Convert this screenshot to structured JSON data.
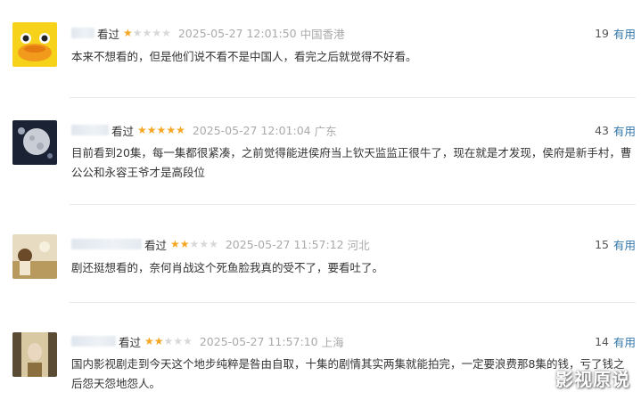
{
  "comments": [
    {
      "username": "",
      "watched_label": "看过",
      "rating": 1,
      "time": "2025-05-27 12:01:50",
      "location": "中国香港",
      "vote_count": "19",
      "vote_label": "有用",
      "content": "本来不想看的，但是他们说不看不是中国人，看完之后就觉得不好看。",
      "avatar": "yellow-duck-avatar"
    },
    {
      "username": "",
      "watched_label": "看过",
      "rating": 5,
      "time": "2025-05-27 12:01:04",
      "location": "广东",
      "vote_count": "43",
      "vote_label": "有用",
      "content": "目前看到20集，每一集都很紧凑，之前觉得能进侯府当上钦天监监正很牛了，现在就是才发现，侯府是新手村，曹公公和永容王爷才是高段位",
      "avatar": "moon-avatar"
    },
    {
      "username": "",
      "watched_label": "看过",
      "rating": 2,
      "time": "2025-05-27 11:57:12",
      "location": "河北",
      "vote_count": "15",
      "vote_label": "有用",
      "content": "剧还挺想看的，奈何肖战这个死鱼脸我真的受不了，要看吐了。",
      "avatar": "field-girl-avatar"
    },
    {
      "username": "",
      "watched_label": "看过",
      "rating": 2,
      "time": "2025-05-27 11:57:10",
      "location": "上海",
      "vote_count": "14",
      "vote_label": "有用",
      "content": "国内影视剧走到今天这个地步纯粹是咎由自取，十集的剧情其实两集就能拍完，一定要浪费那8集的钱，亏了钱之后怨天怨地怨人。",
      "avatar": "elf-avatar"
    }
  ],
  "watermark": "影视原说",
  "colors": {
    "star": "#f5a623",
    "link": "#3377aa",
    "meta": "#aaaaaa"
  }
}
